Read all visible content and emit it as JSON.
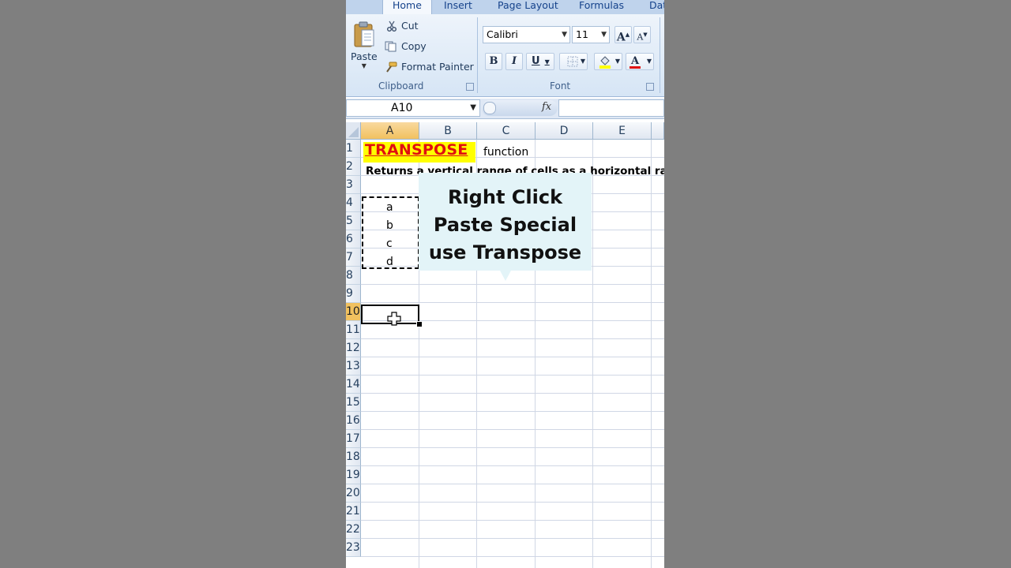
{
  "ribbon": {
    "tabs": [
      "Home",
      "Insert",
      "Page Layout",
      "Formulas",
      "Dat"
    ],
    "clipboard": {
      "paste": "Paste",
      "cut": "Cut",
      "copy": "Copy",
      "format_painter": "Format Painter",
      "label": "Clipboard"
    },
    "font": {
      "name": "Calibri",
      "size": "11",
      "bold": "B",
      "italic": "I",
      "underline": "U",
      "grow": "A",
      "shrink": "A",
      "font_color": "A",
      "label": "Font"
    }
  },
  "formula_bar": {
    "name_box": "A10",
    "fx": "fx",
    "value": ""
  },
  "sheet": {
    "columns": [
      "A",
      "B",
      "C",
      "D",
      "E"
    ],
    "rows": [
      "1",
      "2",
      "3",
      "4",
      "5",
      "6",
      "7",
      "8",
      "9",
      "10",
      "11",
      "12",
      "13",
      "14",
      "15",
      "16",
      "17",
      "18",
      "19",
      "20",
      "21",
      "22",
      "23"
    ],
    "selected_column": "A",
    "selected_row": "10",
    "cells": {
      "A1": "TRANSPOSE",
      "C1": "function",
      "A2": "Returns a vertical range of cells as a horizontal range",
      "A4": "a",
      "A5": "b",
      "A6": "c",
      "A7": "d"
    }
  },
  "callout": {
    "lines": [
      "Right Click",
      "Paste Special",
      "use Transpose"
    ]
  },
  "colors": {
    "accent_yellow": "#ffff00",
    "title_red": "#e01010",
    "callout_bg": "#e3f4f8",
    "selection_orange": "#f1c15f",
    "frame_gray": "#7f7f7f"
  }
}
